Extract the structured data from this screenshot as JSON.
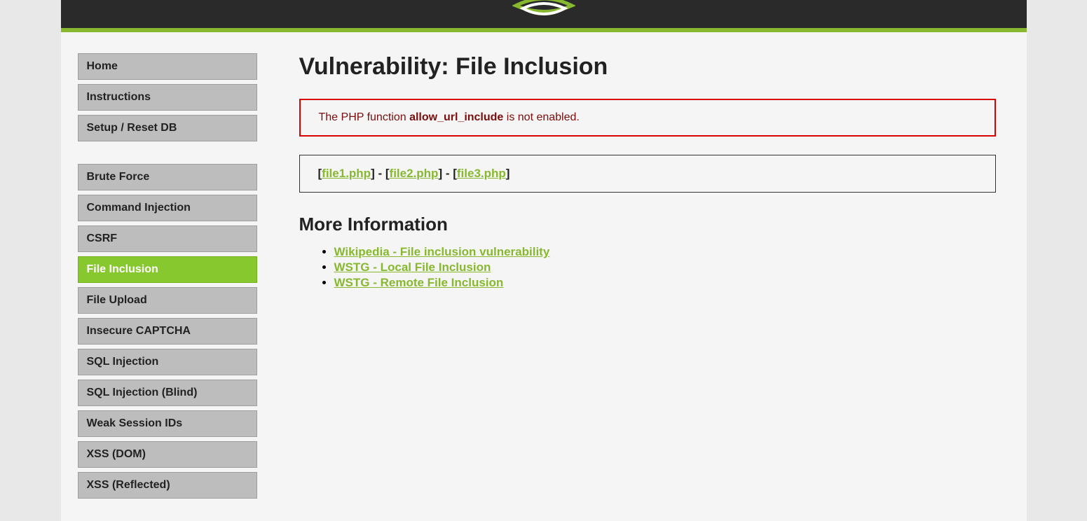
{
  "sidebar": {
    "group1": [
      {
        "label": "Home",
        "active": false,
        "name": "nav-home"
      },
      {
        "label": "Instructions",
        "active": false,
        "name": "nav-instructions"
      },
      {
        "label": "Setup / Reset DB",
        "active": false,
        "name": "nav-setup-reset-db"
      }
    ],
    "group2": [
      {
        "label": "Brute Force",
        "active": false,
        "name": "nav-brute-force"
      },
      {
        "label": "Command Injection",
        "active": false,
        "name": "nav-command-injection"
      },
      {
        "label": "CSRF",
        "active": false,
        "name": "nav-csrf"
      },
      {
        "label": "File Inclusion",
        "active": true,
        "name": "nav-file-inclusion"
      },
      {
        "label": "File Upload",
        "active": false,
        "name": "nav-file-upload"
      },
      {
        "label": "Insecure CAPTCHA",
        "active": false,
        "name": "nav-insecure-captcha"
      },
      {
        "label": "SQL Injection",
        "active": false,
        "name": "nav-sql-injection"
      },
      {
        "label": "SQL Injection (Blind)",
        "active": false,
        "name": "nav-sql-injection-blind"
      },
      {
        "label": "Weak Session IDs",
        "active": false,
        "name": "nav-weak-session-ids"
      },
      {
        "label": "XSS (DOM)",
        "active": false,
        "name": "nav-xss-dom"
      },
      {
        "label": "XSS (Reflected)",
        "active": false,
        "name": "nav-xss-reflected"
      }
    ]
  },
  "main": {
    "title": "Vulnerability: File Inclusion",
    "warning": {
      "prefix": "The PHP function ",
      "bold": "allow_url_include",
      "suffix": " is not enabled."
    },
    "files": [
      {
        "label": "file1.php"
      },
      {
        "label": "file2.php"
      },
      {
        "label": "file3.php"
      }
    ],
    "more_info_heading": "More Information",
    "info_links": [
      {
        "label": "Wikipedia - File inclusion vulnerability"
      },
      {
        "label": "WSTG - Local File Inclusion"
      },
      {
        "label": "WSTG - Remote File Inclusion"
      }
    ]
  }
}
